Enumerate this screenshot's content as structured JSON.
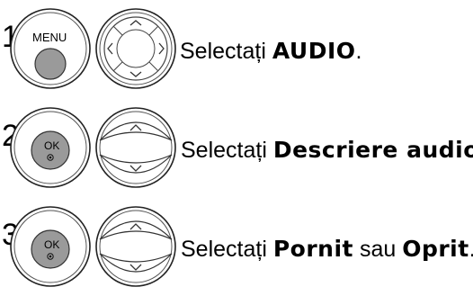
{
  "steps": [
    {
      "number": "1",
      "button": {
        "type": "menu",
        "label": "MENU"
      },
      "nav": "four-way-arrows",
      "text": {
        "prefix": "Selectați ",
        "bold": "AUDIO",
        "suffix": "."
      }
    },
    {
      "number": "2",
      "button": {
        "type": "ok",
        "label": "OK"
      },
      "nav": "up-down-arrows",
      "text": {
        "prefix": "Selectați ",
        "bold": "Descriere audio",
        "suffix": "."
      }
    },
    {
      "number": "3",
      "button": {
        "type": "ok",
        "label": "OK"
      },
      "nav": "up-down-arrows",
      "text": {
        "prefix": "Selectați ",
        "bold": "Pornit",
        "middle": " sau ",
        "bold2": "Oprit",
        "suffix": "."
      }
    }
  ]
}
